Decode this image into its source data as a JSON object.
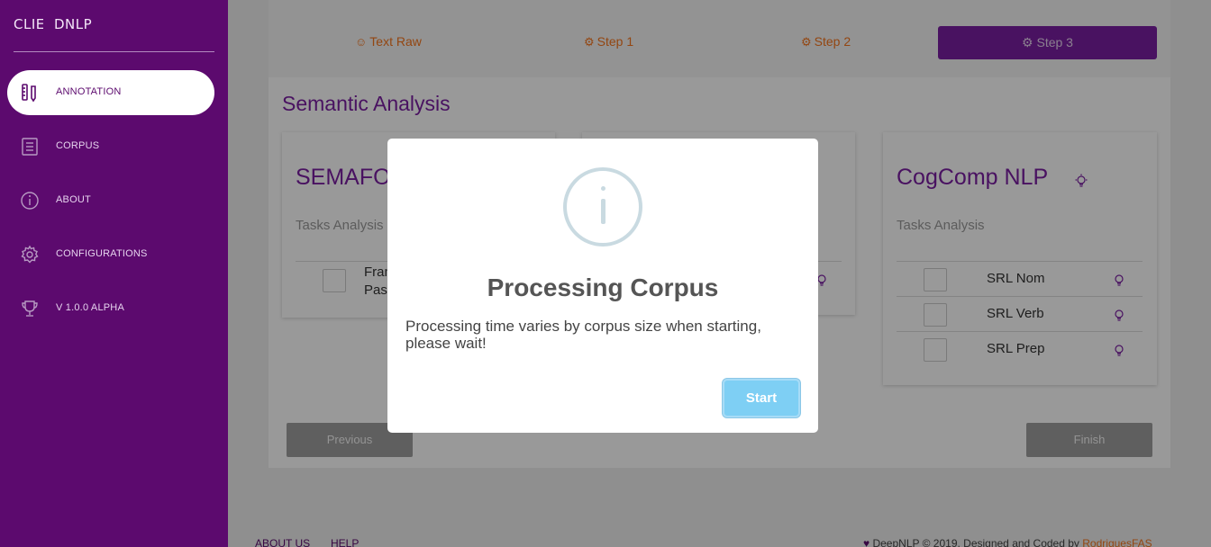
{
  "brand": {
    "mini": "CLIENT",
    "full": "DNLP"
  },
  "sidebar": {
    "items": [
      {
        "label": "ANNOTATION",
        "icon": "annotation-icon",
        "active": true
      },
      {
        "label": "CORPUS",
        "icon": "document-icon"
      },
      {
        "label": "ABOUT",
        "icon": "info-icon"
      },
      {
        "label": "CONFIGURATIONS",
        "icon": "gear-icon"
      },
      {
        "label": "V 1.0.0 ALPHA",
        "icon": "trophy-icon"
      }
    ]
  },
  "wizard": {
    "steps": [
      {
        "label": "Text Raw",
        "icon": "user-circle-icon"
      },
      {
        "label": "Step 1",
        "icon": "gear-icon"
      },
      {
        "label": "Step 2",
        "icon": "gear-icon"
      },
      {
        "label": "Step 3",
        "icon": "gear-icon",
        "active": true
      }
    ]
  },
  "section": {
    "title": "Semantic Analysis"
  },
  "panels": [
    {
      "title": "SEMAFOR",
      "subtitle": "Tasks Analysis",
      "tasks": [
        {
          "label": "Frame",
          "label2": "Pass"
        }
      ]
    },
    {
      "title": "",
      "subtitle": "",
      "tasks": []
    },
    {
      "title": "CogComp NLP",
      "subtitle": "Tasks Analysis",
      "tasks": [
        {
          "label": "SRL Nom"
        },
        {
          "label": "SRL Verb"
        },
        {
          "label": "SRL Prep"
        }
      ]
    }
  ],
  "buttons": {
    "previous": "Previous",
    "finish": "Finish"
  },
  "footer": {
    "links": [
      "ABOUT US",
      "HELP"
    ],
    "copyright": "DeepNLP © 2019. Designed and Coded by",
    "author": "RodriguesFAS"
  },
  "modal": {
    "icon": "info-icon",
    "title": "Processing Corpus",
    "text": "Processing time varies by corpus size when starting, please wait!",
    "button": "Start"
  },
  "colors": {
    "sidebar": "#5c0a6e",
    "accent": "#7b1fa2",
    "step_link": "#f5751d",
    "modal_button": "#7ecff4"
  }
}
